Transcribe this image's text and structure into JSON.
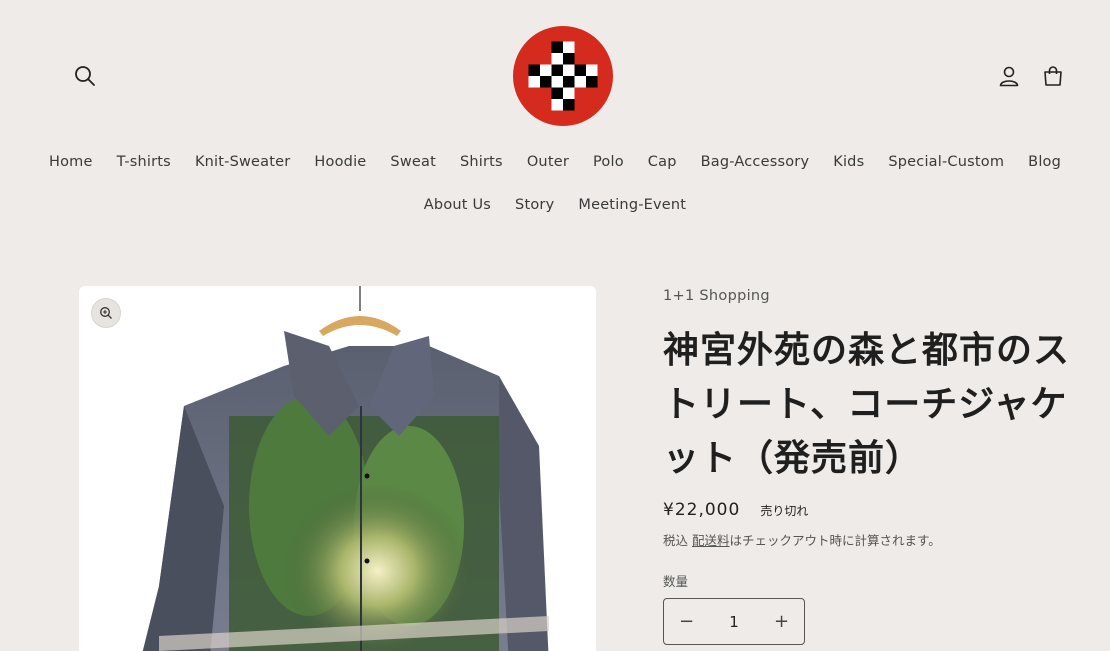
{
  "nav": {
    "row1": [
      "Home",
      "T-shirts",
      "Knit-Sweater",
      "Hoodie",
      "Sweat",
      "Shirts",
      "Outer",
      "Polo",
      "Cap",
      "Bag-Accessory",
      "Kids",
      "Special-Custom",
      "Blog"
    ],
    "row2": [
      "About Us",
      "Story",
      "Meeting-Event"
    ]
  },
  "header": {
    "search_icon": "search-icon",
    "account_icon": "account-icon",
    "cart_icon": "cart-icon",
    "logo_colors": {
      "circle": "#d52b1e",
      "black": "#000000",
      "white": "#ffffff"
    }
  },
  "product": {
    "vendor": "1+1 Shopping",
    "title": "神宮外苑の森と都市のストリート、コーチジャケット（発売前）",
    "price": "¥22,000",
    "badge": "売り切れ",
    "tax_prefix": "税込 ",
    "tax_link": "配送料",
    "tax_suffix": "はチェックアウト時に計算されます。",
    "quantity_label": "数量",
    "quantity_value": "1",
    "minus_symbol": "−",
    "plus_symbol": "+"
  }
}
